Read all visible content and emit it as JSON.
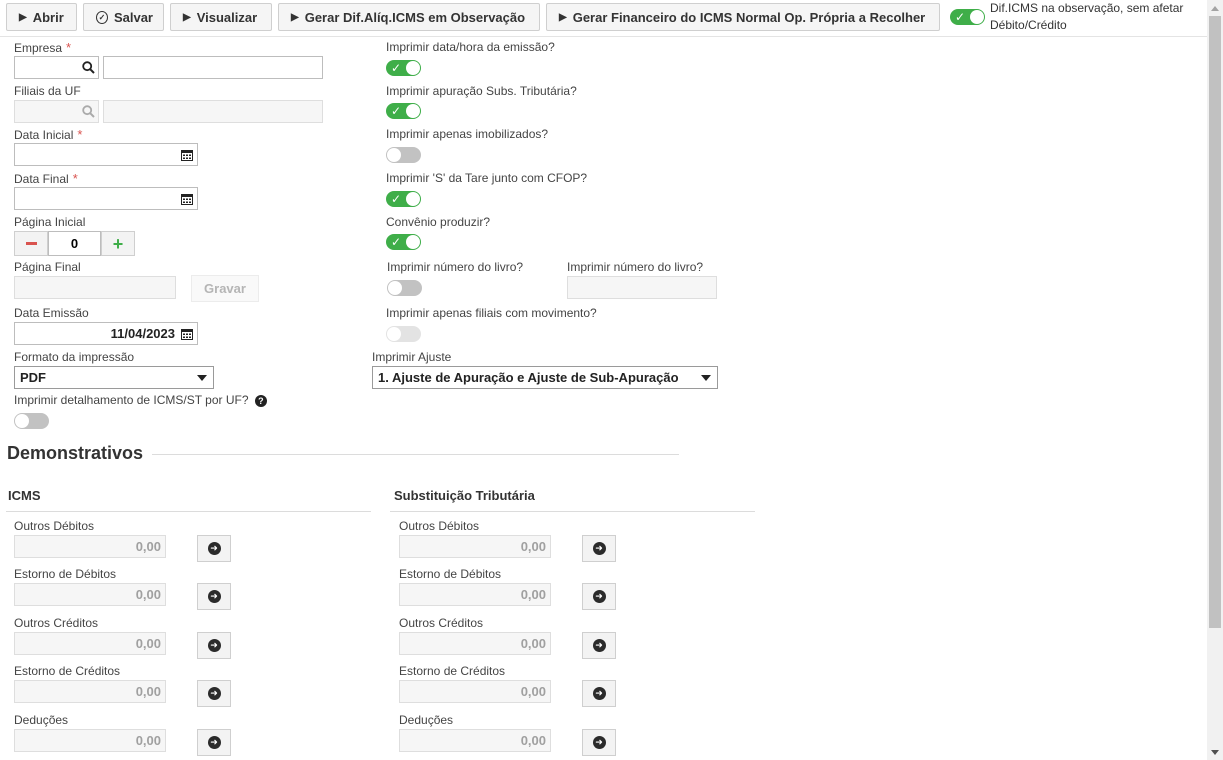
{
  "toolbar": {
    "open_label": "Abrir",
    "save_label": "Salvar",
    "preview_label": "Visualizar",
    "gen_dif_label": "Gerar Dif.Alíq.ICMS em Observação",
    "gen_fin_label": "Gerar Financeiro do ICMS Normal Op. Própria a Recolher",
    "dif_toggle_label_1": "Dif.ICMS na observação, sem afetar",
    "dif_toggle_label_2": "Débito/Crédito",
    "dif_toggle_state": "on"
  },
  "form": {
    "empresa_label": "Empresa",
    "empresa_code": "",
    "empresa_name": "",
    "filiais_label": "Filiais da UF",
    "data_inicial_label": "Data Inicial",
    "data_inicial_value": "",
    "data_final_label": "Data Final",
    "data_final_value": "",
    "pagina_inicial_label": "Página Inicial",
    "pagina_inicial_value": "0",
    "pagina_final_label": "Página Final",
    "gravar_label": "Gravar",
    "data_emissao_label": "Data Emissão",
    "data_emissao_value": "11/04/2023",
    "formato_label": "Formato da impressão",
    "formato_value": "PDF",
    "detalhamento_label": "Imprimir detalhamento de ICMS/ST por UF?",
    "detalhamento_state": "off"
  },
  "options": {
    "data_hora_label": "Imprimir data/hora da emissão?",
    "data_hora_state": "on",
    "subs_trib_label": "Imprimir apuração Subs. Tributária?",
    "subs_trib_state": "on",
    "imobilizados_label": "Imprimir apenas imobilizados?",
    "imobilizados_state": "off",
    "tare_label": "Imprimir 'S' da Tare junto com CFOP?",
    "tare_state": "on",
    "convenio_label": "Convênio produzir?",
    "convenio_state": "on",
    "num_livro_label": "Imprimir número do livro?",
    "num_livro_state": "off",
    "num_livro_label_2": "Imprimir número do livro?",
    "num_livro_value": "",
    "filiais_mov_label": "Imprimir apenas filiais com movimento?",
    "filiais_mov_state": "disabled",
    "ajuste_label": "Imprimir Ajuste",
    "ajuste_value": "1. Ajuste de Apuração e Ajuste de Sub-Apuração"
  },
  "demonstrativos": {
    "title": "Demonstrativos",
    "icms": {
      "title": "ICMS",
      "rows": [
        {
          "label": "Outros Débitos",
          "value": "0,00"
        },
        {
          "label": "Estorno de Débitos",
          "value": "0,00"
        },
        {
          "label": "Outros Créditos",
          "value": "0,00"
        },
        {
          "label": "Estorno de Créditos",
          "value": "0,00"
        },
        {
          "label": "Deduções",
          "value": "0,00"
        }
      ]
    },
    "st": {
      "title": "Substituição Tributária",
      "rows": [
        {
          "label": "Outros Débitos",
          "value": "0,00"
        },
        {
          "label": "Estorno de Débitos",
          "value": "0,00"
        },
        {
          "label": "Outros Créditos",
          "value": "0,00"
        },
        {
          "label": "Estorno de Créditos",
          "value": "0,00"
        },
        {
          "label": "Deduções",
          "value": "0,00"
        }
      ]
    }
  },
  "icons": {
    "play": "play-icon",
    "check_circle": "check-circle-icon",
    "search": "search-icon",
    "calendar": "calendar-icon",
    "minus": "minus-icon",
    "plus": "plus-icon",
    "question": "question-circle-icon",
    "arrow_right": "arrow-right-circle-icon"
  },
  "colors": {
    "toggle_on": "#3fae49",
    "toggle_off": "#c2c2c2",
    "required": "#d9534f",
    "minus": "#d9534f",
    "plus": "#3fae49"
  }
}
